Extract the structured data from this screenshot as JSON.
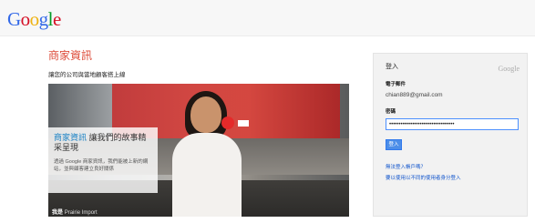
{
  "logo": {
    "letters": [
      "G",
      "o",
      "o",
      "g",
      "l",
      "e"
    ],
    "colors": [
      "#3369e8",
      "#d50f25",
      "#eeb211",
      "#3369e8",
      "#009925",
      "#d50f25"
    ]
  },
  "header": {
    "title": "商家資訊",
    "subtitle": "讓您的公司與當地顧客搭上線"
  },
  "hero": {
    "headline_accent": "商家資訊",
    "headline_rest": "讓我們的故事精采呈現",
    "body": "透過 Google 商家資訊，我們能被上新的網站，並與顧客建立良好關係",
    "caption_name": "我是",
    "caption_role": "Prairie Import"
  },
  "login": {
    "title": "登入",
    "brand": "Google",
    "email_label": "電子郵件",
    "email_value": "chian889@gmail.com",
    "password_label": "密碼",
    "password_value": "••••••••••••••••••••••••••••••••••",
    "signin_label": "登入",
    "link_cant_access": "無法登入帳戶嗎？",
    "link_other_account": "要以使用以不同的使用者身分登入"
  },
  "colors": {
    "accent_red": "#dd4b39",
    "link_blue": "#1155cc",
    "button_blue": "#4d8ee8"
  }
}
